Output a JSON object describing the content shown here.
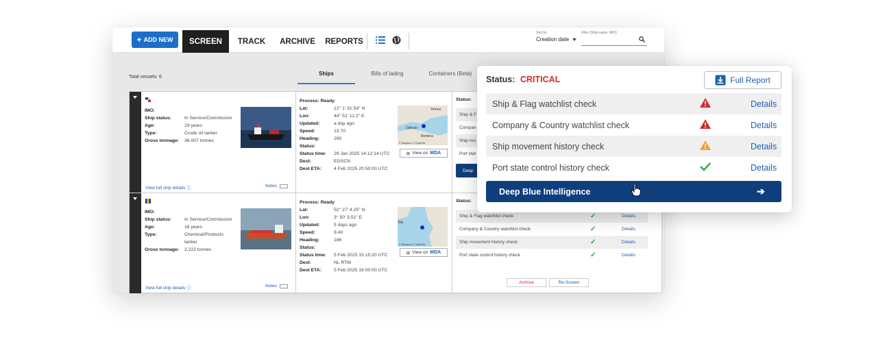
{
  "navbar": {
    "add_new": "ADD NEW",
    "tabs": [
      "SCREEN",
      "TRACK",
      "ARCHIVE",
      "REPORTS"
    ],
    "sort_by_label": "Sort by",
    "sort_by_value": "Creation date",
    "filter_label": "Filter (Ship name, IMO)"
  },
  "content": {
    "total_vessels": "Total vessels: 6",
    "subtabs": [
      "Ships",
      "Bills of lading",
      "Containers (Beta)"
    ]
  },
  "vessels": [
    {
      "imo_label": "IMO:",
      "fields": [
        {
          "k": "Ship status:",
          "v": "In Service/Commission"
        },
        {
          "k": "Age:",
          "v": "19 years"
        },
        {
          "k": "Type:",
          "v": "Crude oil tanker"
        },
        {
          "k": "Gross tonnage:",
          "v": "36,007 tonnes"
        }
      ],
      "process": "Process: Ready",
      "details": [
        {
          "k": "Lat:",
          "v": "12° 1' 31.54\" N"
        },
        {
          "k": "Lon:",
          "v": "44° 51' 11.2\" E"
        },
        {
          "k": "Updated:",
          "v": "a day ago"
        },
        {
          "k": "Speed:",
          "v": "13.70"
        },
        {
          "k": "Heading:",
          "v": "290"
        },
        {
          "k": "Status:",
          "v": ""
        },
        {
          "k": "Status time:",
          "v": "29 Jan 2025 14:12:14 UTC"
        },
        {
          "k": "Dest:",
          "v": "EGSCN"
        },
        {
          "k": "Dest ETA:",
          "v": "4 Feb 2025 20:50:00 UTC"
        }
      ],
      "map_labels": [
        "Yemen",
        "Djibouti",
        "Berbera"
      ],
      "status_label": "Status:",
      "checks_partial": [
        "Ship & F",
        "Compan",
        "Ship mo",
        "Port stat"
      ],
      "dbi_short": "Deep"
    },
    {
      "imo_label": "IMO:",
      "fields": [
        {
          "k": "Ship status:",
          "v": "In Service/Commission"
        },
        {
          "k": "Age:",
          "v": "16 years"
        },
        {
          "k": "Type:",
          "v": "Chemical/Products tanker"
        },
        {
          "k": "Gross tonnage:",
          "v": "2,222 tonnes"
        }
      ],
      "process": "Process: Ready",
      "details": [
        {
          "k": "Lat:",
          "v": "52° 27' 4.25\" N"
        },
        {
          "k": "Lon:",
          "v": "3° 50' 3.51\" E"
        },
        {
          "k": "Updated:",
          "v": "5 days ago"
        },
        {
          "k": "Speed:",
          "v": "9.40"
        },
        {
          "k": "Heading:",
          "v": "186"
        },
        {
          "k": "Status:",
          "v": ""
        },
        {
          "k": "Status time:",
          "v": "5 Feb 2025 15:15:20 UTC"
        },
        {
          "k": "Dest:",
          "v": "NL RTM"
        },
        {
          "k": "Dest ETA:",
          "v": "5 Feb 2025 16:00:00 UTC"
        }
      ],
      "status_label": "Status:",
      "checks": [
        "Ship & Flag watchlist check",
        "Company & Country watchlist check",
        "Ship movement history check",
        "Port state control history check"
      ],
      "archive": "Archive",
      "rescreen": "Re-Screen"
    }
  ],
  "common": {
    "view_full": "View full ship details",
    "notes": "Notes",
    "view_on": "View on",
    "mda": "MDA",
    "details": "Details",
    "map_attrib": "© Mapbox © OpenStr"
  },
  "popup": {
    "status_label": "Status:",
    "status_value": "CRITICAL",
    "full_report": "Full Report",
    "checks": [
      {
        "label": "Ship & Flag watchlist check",
        "icon": "critical-warning-icon"
      },
      {
        "label": "Company & Country watchlist check",
        "icon": "critical-warning-icon"
      },
      {
        "label": "Ship movement history check",
        "icon": "warning-icon"
      },
      {
        "label": "Port state control history check",
        "icon": "check-icon"
      }
    ],
    "details": "Details",
    "dbi": "Deep Blue Intelligence"
  },
  "colors": {
    "critical": "#d32a2a",
    "warning": "#f0a030",
    "ok": "#27a844",
    "brand": "#0f3e7d",
    "link": "#1c5fb0"
  }
}
